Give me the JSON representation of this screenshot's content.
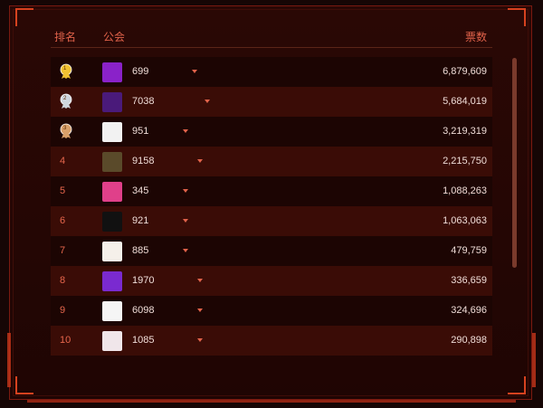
{
  "header": {
    "rank_label": "排名",
    "guild_label": "公会",
    "votes_label": "票数"
  },
  "colors": {
    "accent": "#e0624a",
    "row_dark": "#1c0503",
    "row_light": "#3a0c06",
    "gold": "#f1c232",
    "silver": "#cfd6de",
    "bronze": "#d9a06a"
  },
  "rows": [
    {
      "rank": "1",
      "medal": "gold-medal-icon",
      "guild": "699",
      "votes": "6,879,609",
      "logo": "#8a22c9"
    },
    {
      "rank": "2",
      "medal": "silver-medal-icon",
      "guild": "7038",
      "votes": "5,684,019",
      "logo": "#4a1a7a"
    },
    {
      "rank": "3",
      "medal": "bronze-medal-icon",
      "guild": "951",
      "votes": "3,219,319",
      "logo": "#f2f2f2"
    },
    {
      "rank": "4",
      "guild": "9158",
      "votes": "2,215,750",
      "logo": "#5a4a2a"
    },
    {
      "rank": "5",
      "guild": "345",
      "votes": "1,088,263",
      "logo": "#e0408a"
    },
    {
      "rank": "6",
      "guild": "921",
      "votes": "1,063,063",
      "logo": "#111111"
    },
    {
      "rank": "7",
      "guild": "885",
      "votes": "479,759",
      "logo": "#f5f0ea"
    },
    {
      "rank": "8",
      "guild": "1970",
      "votes": "336,659",
      "logo": "#7a2ad0"
    },
    {
      "rank": "9",
      "guild": "6098",
      "votes": "324,696",
      "logo": "#f5f5f5"
    },
    {
      "rank": "10",
      "guild": "1085",
      "votes": "290,898",
      "logo": "#f0e6ea"
    }
  ]
}
